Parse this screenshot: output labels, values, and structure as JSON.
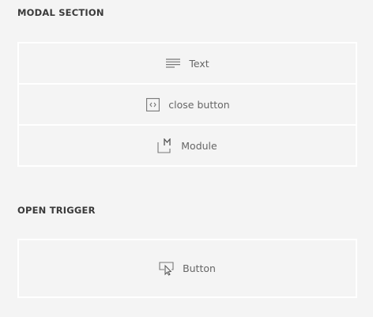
{
  "modal_section": {
    "title": "MODAL SECTION",
    "items": [
      {
        "label": "Text",
        "icon": "text-lines-icon"
      },
      {
        "label": "close button",
        "icon": "code-icon"
      },
      {
        "label": "Module",
        "icon": "module-icon"
      }
    ]
  },
  "open_trigger": {
    "title": "OPEN TRIGGER",
    "items": [
      {
        "label": "Button",
        "icon": "button-cursor-icon"
      }
    ]
  }
}
